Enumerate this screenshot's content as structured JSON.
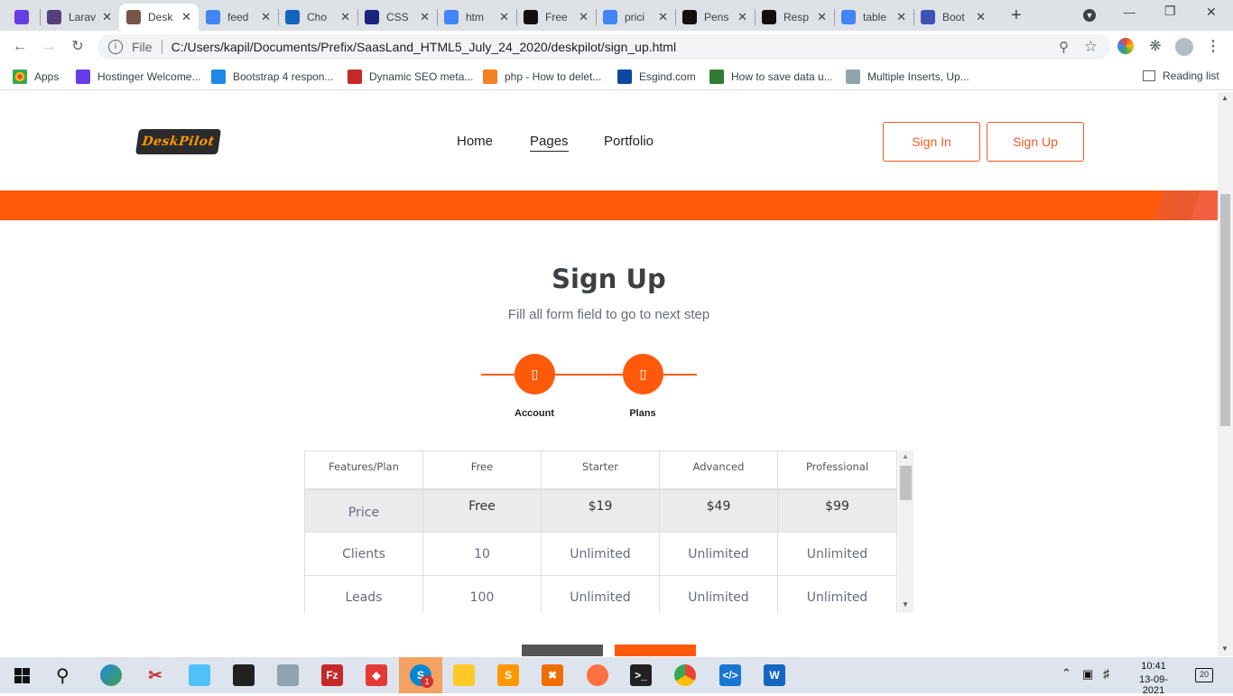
{
  "browser": {
    "tabs": [
      {
        "title": "",
        "icon": "hostinger-icon",
        "color": "#673de6"
      },
      {
        "title": "Larav",
        "icon": "bootstrap-b-icon",
        "color": "#563d7c"
      },
      {
        "title": "Desk",
        "icon": "person-icon",
        "color": "#795548",
        "active": true
      },
      {
        "title": "feed",
        "icon": "google-icon",
        "color": "#4285f4"
      },
      {
        "title": "Cho",
        "icon": "app-icon",
        "color": "#1565c0"
      },
      {
        "title": "CSS",
        "icon": "code-icon",
        "color": "#1a237e"
      },
      {
        "title": "htm",
        "icon": "google-icon",
        "color": "#4285f4"
      },
      {
        "title": "Free",
        "icon": "ff-icon",
        "color": "#111111"
      },
      {
        "title": "prici",
        "icon": "google-icon",
        "color": "#4285f4"
      },
      {
        "title": "Pens",
        "icon": "codepen-icon",
        "color": "#111111"
      },
      {
        "title": "Resp",
        "icon": "codepen-icon",
        "color": "#111111"
      },
      {
        "title": "table",
        "icon": "google-icon",
        "color": "#4285f4"
      },
      {
        "title": "Boot",
        "icon": "mdb-icon",
        "color": "#3f51b5"
      }
    ],
    "address": {
      "prefix": "File",
      "url": "C:/Users/kapil/Documents/Prefix/SaasLand_HTML5_July_24_2020/deskpilot/sign_up.html"
    },
    "bookmarks": [
      {
        "label": "Apps",
        "color": "#ea4335"
      },
      {
        "label": "Hostinger Welcome...",
        "color": "#673de6"
      },
      {
        "label": "Bootstrap 4 respon...",
        "color": "#1e88e5"
      },
      {
        "label": "Dynamic SEO meta...",
        "color": "#c62828"
      },
      {
        "label": "php - How to delet...",
        "color": "#f48024"
      },
      {
        "label": "Esgind.com",
        "color": "#0d47a1"
      },
      {
        "label": "How to save data u...",
        "color": "#2e7d32"
      },
      {
        "label": "Multiple Inserts, Up...",
        "color": "#90a4ae"
      }
    ],
    "reading_list": "Reading list"
  },
  "site": {
    "logo_text": "DeskPilot",
    "nav": [
      "Home",
      "Pages",
      "Portfolio"
    ],
    "active_nav": "Pages",
    "sign_in": "Sign In",
    "sign_up": "Sign Up",
    "accent": "#ff5a0a"
  },
  "signup": {
    "title": "Sign Up",
    "subtitle": "Fill all form field to go to next step",
    "steps": [
      {
        "label": "Account",
        "glyph": "▯"
      },
      {
        "label": "Plans",
        "glyph": "▯"
      }
    ]
  },
  "table": {
    "headers": [
      "Features/Plan",
      "Free",
      "Starter",
      "Advanced",
      "Professional"
    ],
    "rows": [
      [
        "Price",
        "Free",
        "$19",
        "$49",
        "$99"
      ],
      [
        "Clients",
        "10",
        "Unlimited",
        "Unlimited",
        "Unlimited"
      ],
      [
        "Leads",
        "100",
        "Unlimited",
        "Unlimited",
        "Unlimited"
      ]
    ]
  },
  "taskbar": {
    "time": "10:41",
    "date": "13-09-2021",
    "notification_count": "20",
    "skype_badge": "1"
  }
}
